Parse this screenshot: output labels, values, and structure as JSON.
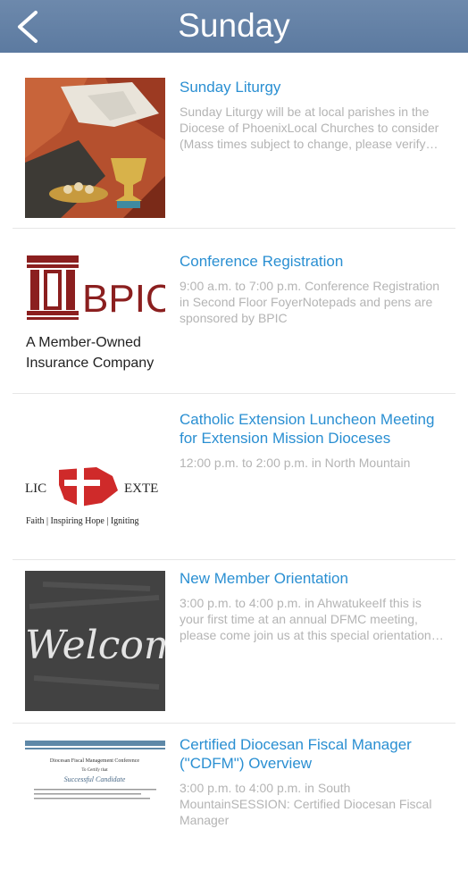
{
  "header": {
    "title": "Sunday"
  },
  "events": [
    {
      "title": "Sunday Liturgy",
      "desc": "Sunday Liturgy will be at local parishes in the Diocese of PhoenixLocal Churches to consider (Mass times subject to change, please verify with the parish before attending)",
      "image": "liturgy-stained-glass"
    },
    {
      "title": "Conference Registration",
      "desc": "9:00 a.m. to 7:00 p.m. Conference Registration in Second Floor FoyerNotepads and pens are sponsored by BPIC",
      "image": "bpic-logo",
      "logo_text": "BPIC",
      "logo_line1": "A Member-Owned",
      "logo_line2": "Insurance Company"
    },
    {
      "title": "Catholic Extension Luncheon Meeting for Extension Mission Dioceses",
      "desc": "12:00 p.m. to 2:00 p.m. in North Mountain",
      "image": "catholic-extension-logo",
      "logo_left": "LIC",
      "logo_right": "EXTE",
      "logo_tagline": "Faith | Inspiring Hope | Igniting"
    },
    {
      "title": "New Member Orientation",
      "desc": "3:00 p.m. to 4:00 p.m. in AhwatukeeIf this is your first time at an annual DFMC meeting, please come join us at this special orientation session",
      "image": "welcome-chalkboard",
      "chalk_text": "Welcome"
    },
    {
      "title": "Certified Diocesan Fiscal Manager (\"CDFM\") Overview",
      "desc": "3:00 p.m. to 4:00 p.m. in South MountainSESSION: Certified Diocesan Fiscal Manager",
      "image": "cdfm-certificate",
      "cert_heading": "Diocesan Fiscal Management Conference",
      "cert_sub": "To Certify that",
      "cert_name": "Successful Candidate"
    }
  ],
  "colors": {
    "header": "#5f7ea3",
    "title_link": "#2a8fd2",
    "desc": "#b4b4b4"
  }
}
